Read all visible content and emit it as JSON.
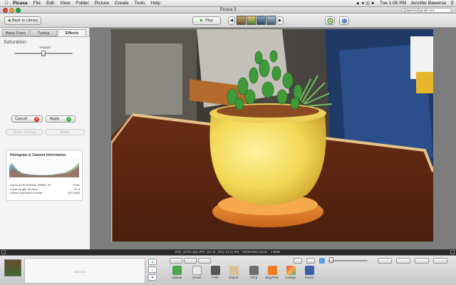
{
  "menubar": {
    "app": "Picasa",
    "items": [
      "File",
      "Edit",
      "View",
      "Folder",
      "Picture",
      "Create",
      "Tools",
      "Help"
    ],
    "clock": "Tue 1:05 PM",
    "user": "Jennifer Bawerse"
  },
  "window": {
    "title": "Picasa 3",
    "account_email": "jbawerse@gmail.com"
  },
  "toolbar": {
    "back_label": "Back to Library",
    "play_label": "Play"
  },
  "left_panel": {
    "tabs": [
      "Basic Fixes",
      "Tuning",
      "Effects"
    ],
    "active_tab": "Effects",
    "effect_name": "Saturation",
    "amount_label": "Amount",
    "amount_value": 0.5,
    "cancel_label": "Cancel",
    "apply_label": "Apply",
    "disabled_buttons": [
      "Undo Tuning",
      "Redo"
    ],
    "histogram_title": "Histogram & Camera Information",
    "camera_info": [
      [
        "Canon EOS DIGITAL REBEL XT",
        "1/30s"
      ],
      [
        "Focal Length 35.0mm",
        "f/2.8"
      ],
      [
        "(35mm equivalent 57mm)",
        "ISO 1600"
      ]
    ]
  },
  "status_bar": {
    "filename": "IMG_3275-copy.JPG",
    "date": "Oct 11, 2011 12:11 PM",
    "dimensions": "2048x2292 pixels",
    "size": "4.6MB"
  },
  "tray": {
    "selection_label": "Selection",
    "tools": [
      "Upload",
      "Email",
      "Print",
      "Export",
      "Shop",
      "BlogThis!",
      "Collage",
      "Movie"
    ]
  },
  "colors": {
    "panel_bg": "#f4f4f4",
    "viewer_bg": "#7d7d7d",
    "apply_green": "#3db34a",
    "cancel_red": "#d83a2f"
  }
}
